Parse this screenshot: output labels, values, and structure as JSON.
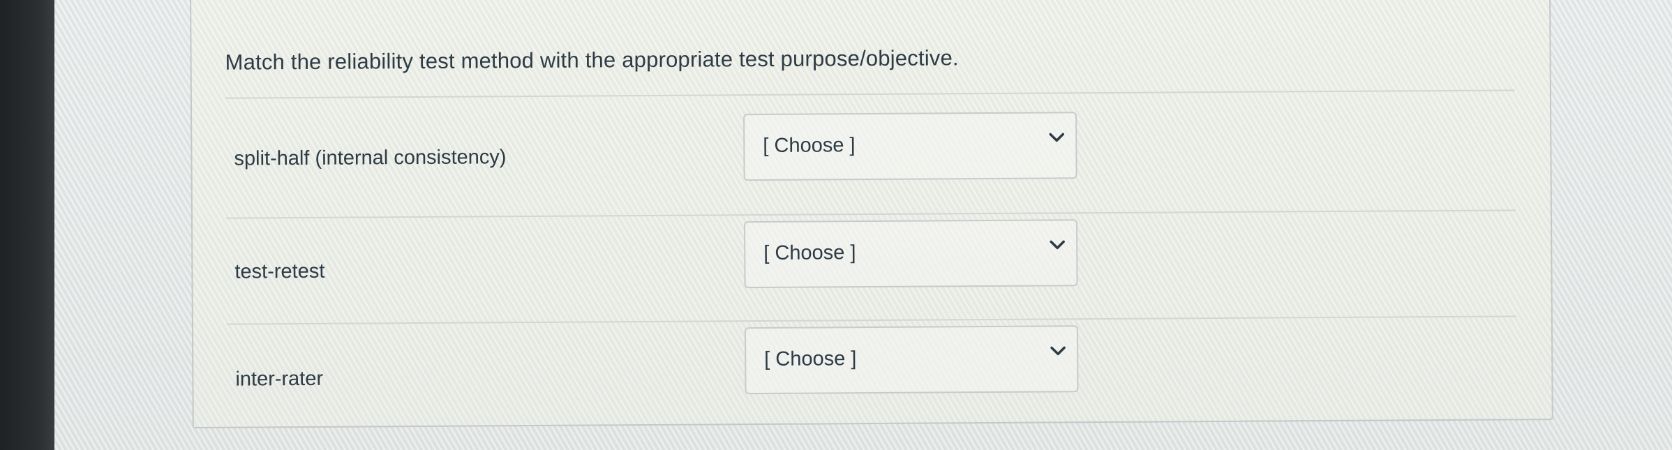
{
  "question": {
    "text": "Match the reliability test method with the appropriate test purpose/objective."
  },
  "rows": [
    {
      "label": "split-half (internal consistency)",
      "select_value": "[ Choose ]",
      "icon": "chevron-down-icon"
    },
    {
      "label": "test-retest",
      "select_value": "[ Choose ]",
      "icon": "chevron-down-icon"
    },
    {
      "label": "inter-rater",
      "select_value": "[ Choose ]",
      "icon": "chevron-down-icon"
    }
  ],
  "colors": {
    "text": "#2d3b45",
    "border": "#c7cbcb",
    "background": "#e4e6e6"
  }
}
